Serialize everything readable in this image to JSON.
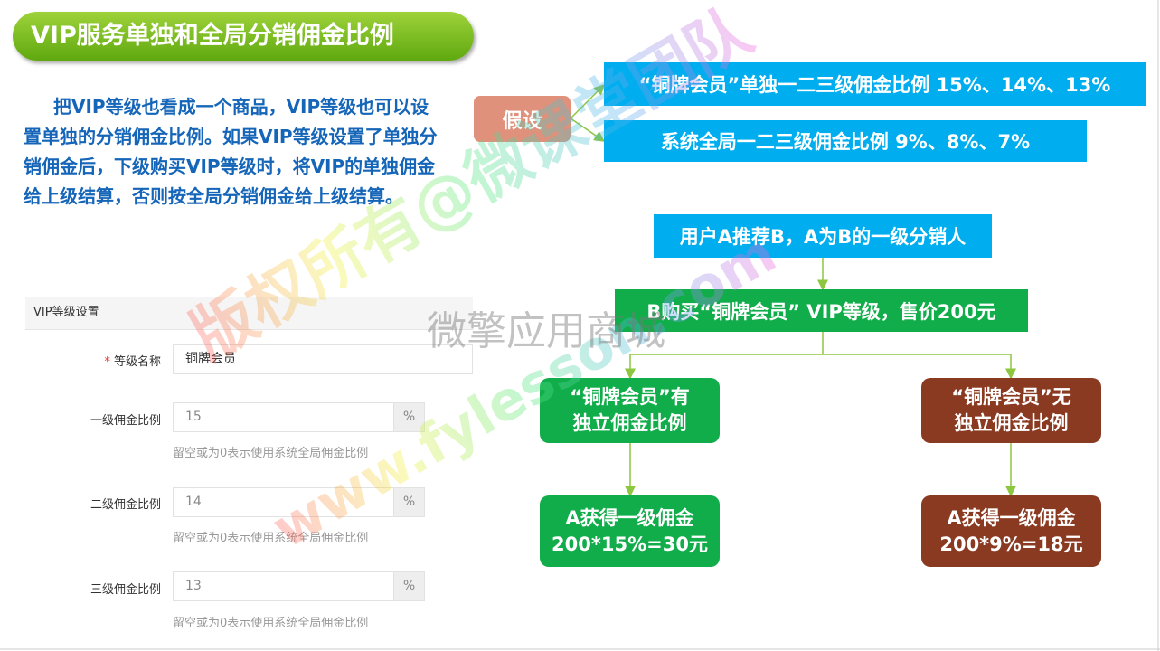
{
  "title": "VIP服务单独和全局分销佣金比例",
  "paragraph": "把VIP等级也看成一个商品，VIP等级也可以设置单独的分销佣金比例。如果VIP等级设置了单独分销佣金后，下级购买VIP等级时，将VIP的单独佣金给上级结算，否则按全局分销佣金给上级结算。",
  "form": {
    "header": "VIP等级设置",
    "required_mark": "*",
    "name_label": "等级名称",
    "name_value": "铜牌会员",
    "rows": [
      {
        "label": "一级佣金比例",
        "value": "15",
        "unit": "%",
        "help": "留空或为0表示使用系统全局佣金比例"
      },
      {
        "label": "二级佣金比例",
        "value": "14",
        "unit": "%",
        "help": "留空或为0表示使用系统全局佣金比例"
      },
      {
        "label": "三级佣金比例",
        "value": "13",
        "unit": "%",
        "help": "留空或为0表示使用系统全局佣金比例"
      }
    ]
  },
  "diagram": {
    "assume": "假设",
    "assume1": "“铜牌会员”单独一二三级佣金比例 15%、14%、13%",
    "assume2": "系统全局一二三级佣金比例 9%、8%、7%",
    "step1": "用户A推荐B，A为B的一级分销人",
    "step2": "B购买“铜牌会员” VIP等级，售价200元",
    "left_cond": [
      "“铜牌会员”有",
      "独立佣金比例"
    ],
    "right_cond": [
      "“铜牌会员”无",
      "独立佣金比例"
    ],
    "left_result": [
      "A获得一级佣金",
      "200*15%=30元"
    ],
    "right_result": [
      "A获得一级佣金",
      "200*9%=18元"
    ]
  },
  "watermarks": {
    "a": "版权所有@微课堂团队",
    "b": "www.fylesson.com",
    "c": "微擎应用商城"
  },
  "colors": {
    "blue": "#00aeef",
    "green": "#12ad4b",
    "brown": "#8b3a22",
    "assume": "#e0917c",
    "line": "#8dc63f"
  }
}
